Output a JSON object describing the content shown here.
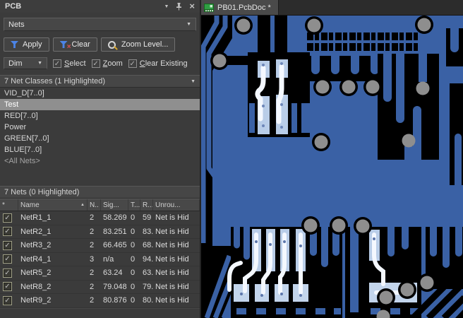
{
  "panel": {
    "title": "PCB",
    "filter_type": "Nets",
    "apply_label": "Apply",
    "clear_label": "Clear",
    "zoom_level_label": "Zoom Level...",
    "dim_mode": "Dim",
    "checkbox_select": "Select",
    "checkbox_zoom": "Zoom",
    "checkbox_clear_existing": "Clear Existing",
    "classes_header": "7 Net Classes (1 Highlighted)",
    "classes": [
      {
        "name": "VID_D[7..0]"
      },
      {
        "name": "Test",
        "selected": true
      },
      {
        "name": "RED[7..0]"
      },
      {
        "name": "Power"
      },
      {
        "name": "GREEN[7..0]"
      },
      {
        "name": "BLUE[7..0]"
      },
      {
        "name": "<All Nets>"
      }
    ],
    "nets_header": "7 Nets (0 Highlighted)",
    "nets_table": {
      "columns": [
        "*",
        "Name",
        "N..",
        "Sig...",
        "T...",
        "R...",
        "Unrou..."
      ],
      "rows": [
        {
          "name": "NetR1_1",
          "nodes": "2",
          "signal": "58.269",
          "t": "0",
          "routed": "59",
          "status": "Net is Hid"
        },
        {
          "name": "NetR2_1",
          "nodes": "2",
          "signal": "83.251",
          "t": "0",
          "routed": "83.",
          "status": "Net is Hid"
        },
        {
          "name": "NetR3_2",
          "nodes": "2",
          "signal": "66.465",
          "t": "0",
          "routed": "68.",
          "status": "Net is Hid"
        },
        {
          "name": "NetR4_1",
          "nodes": "3",
          "signal": "n/a",
          "t": "0",
          "routed": "94.",
          "status": "Net is Hid"
        },
        {
          "name": "NetR5_2",
          "nodes": "2",
          "signal": "63.24",
          "t": "0",
          "routed": "63.",
          "status": "Net is Hid"
        },
        {
          "name": "NetR8_2",
          "nodes": "2",
          "signal": "79.048",
          "t": "0",
          "routed": "79.",
          "status": "Net is Hid"
        },
        {
          "name": "NetR9_2",
          "nodes": "2",
          "signal": "80.876",
          "t": "0",
          "routed": "80.",
          "status": "Net is Hid"
        }
      ]
    }
  },
  "editor": {
    "tab_label": "PB01.PcbDoc *"
  },
  "icons": {
    "check": "✓",
    "close": "×",
    "dropdown": "▼",
    "collapse": "▼",
    "sort_asc": "▲",
    "star": "*"
  },
  "colors": {
    "copper_blue": "#3a61a5",
    "clearance_black": "#000000",
    "via_gray": "#8e8e8e",
    "highlight_pad": "#b9cde8",
    "highlight_trace": "#f4f8ff",
    "selection_gray": "#8f8f8f",
    "panel_bg": "#3b3b3b"
  }
}
